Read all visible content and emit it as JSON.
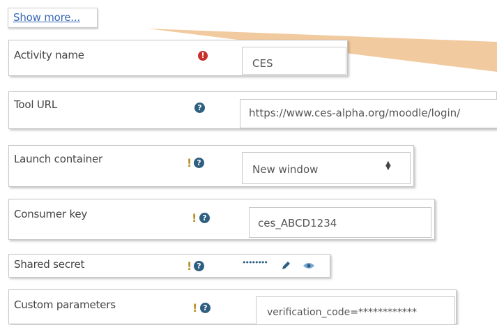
{
  "show_more": {
    "label": "Show more..."
  },
  "fields": {
    "activity_name": {
      "label": "Activity name",
      "value": "CES"
    },
    "tool_url": {
      "label": "Tool URL",
      "value": "https://www.ces-alpha.org/moodle/login/"
    },
    "launch_container": {
      "label": "Launch container",
      "value": "New window"
    },
    "consumer_key": {
      "label": "Consumer key",
      "value": "ces_ABCD1234"
    },
    "shared_secret": {
      "label": "Shared secret",
      "value": "••••••••"
    },
    "custom_parameters": {
      "label": "Custom parameters",
      "value": "verification_code=************"
    }
  },
  "icons": {
    "required": "exclamation-circle-icon",
    "help": "question-circle-icon",
    "advanced": "exclamation-icon",
    "edit": "pencil-icon",
    "reveal": "eye-icon"
  },
  "colors": {
    "link": "#3869b4",
    "required": "#c9302c",
    "help": "#2f5f80",
    "advanced": "#b8912a",
    "beam": "#f1c79a"
  }
}
